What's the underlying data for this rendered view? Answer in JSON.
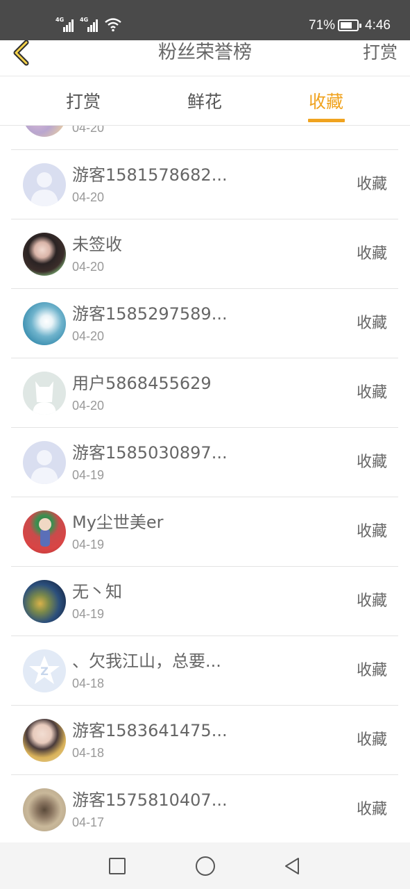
{
  "status_bar": {
    "network_1": "4G",
    "network_2": "4G",
    "battery_percent": "71%",
    "battery_level": 0.71,
    "time": "4:46",
    "icons": [
      "signal-icon",
      "signal-icon",
      "wifi-icon",
      "battery-icon"
    ]
  },
  "header": {
    "back_icon": "chevron-left-icon",
    "title": "粉丝荣誉榜",
    "right_link": "打赏",
    "accent_color": "#f0a31f"
  },
  "tabs": [
    {
      "label": "打赏",
      "active": false
    },
    {
      "label": "鲜花",
      "active": false
    },
    {
      "label": "收藏",
      "active": true
    }
  ],
  "list": {
    "partial_top_date": "04-20",
    "items": [
      {
        "name": "游客1581578682...",
        "date": "04-20",
        "action": "收藏",
        "avatar": "default-avatar"
      },
      {
        "name": "未签收",
        "date": "04-20",
        "action": "收藏",
        "avatar": "photo-avatar"
      },
      {
        "name": "游客1585297589...",
        "date": "04-20",
        "action": "收藏",
        "avatar": "photo-avatar"
      },
      {
        "name": "用户5868455629",
        "date": "04-20",
        "action": "收藏",
        "avatar": "default-avatar"
      },
      {
        "name": "游客1585030897...",
        "date": "04-19",
        "action": "收藏",
        "avatar": "default-avatar"
      },
      {
        "name": "My尘世美er",
        "date": "04-19",
        "action": "收藏",
        "avatar": "photo-avatar"
      },
      {
        "name": "无丶知",
        "date": "04-19",
        "action": "收藏",
        "avatar": "photo-avatar"
      },
      {
        "name": "、欠我江山，总要...",
        "date": "04-18",
        "action": "收藏",
        "avatar": "qq-avatar"
      },
      {
        "name": "游客1583641475...",
        "date": "04-18",
        "action": "收藏",
        "avatar": "photo-avatar"
      },
      {
        "name": "游客1575810407...",
        "date": "04-17",
        "action": "收藏",
        "avatar": "photo-avatar"
      }
    ]
  },
  "nav_bar": {
    "icons": [
      "recent-apps-icon",
      "home-icon",
      "back-triangle-icon"
    ]
  }
}
